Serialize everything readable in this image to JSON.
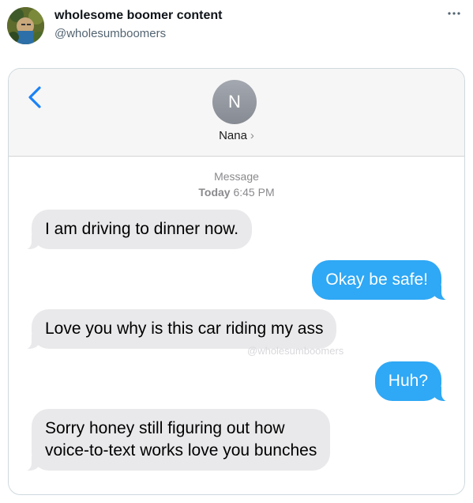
{
  "post": {
    "display_name": "wholesome boomer content",
    "handle": "@wholesumboomers",
    "more_icon": "more-horizontal-icon"
  },
  "chat": {
    "contact_initial": "N",
    "contact_name": "Nana",
    "back_icon": "chevron-left-icon",
    "meta_label": "Message",
    "meta_day": "Today",
    "meta_time": "6:45 PM",
    "watermark": "@wholesumboomers",
    "colors": {
      "outgoing": "#2fa8f5",
      "incoming": "#e9e9eb",
      "accent": "#1a82f7"
    },
    "messages": [
      {
        "direction": "incoming",
        "text": "I am driving to dinner now."
      },
      {
        "direction": "outgoing",
        "text": "Okay be safe!"
      },
      {
        "direction": "incoming",
        "text": "Love you why is this car riding my ass"
      },
      {
        "direction": "outgoing",
        "text": "Huh?"
      },
      {
        "direction": "incoming",
        "text": "Sorry honey still figuring out how\nvoice-to-text works love you bunches"
      }
    ]
  }
}
